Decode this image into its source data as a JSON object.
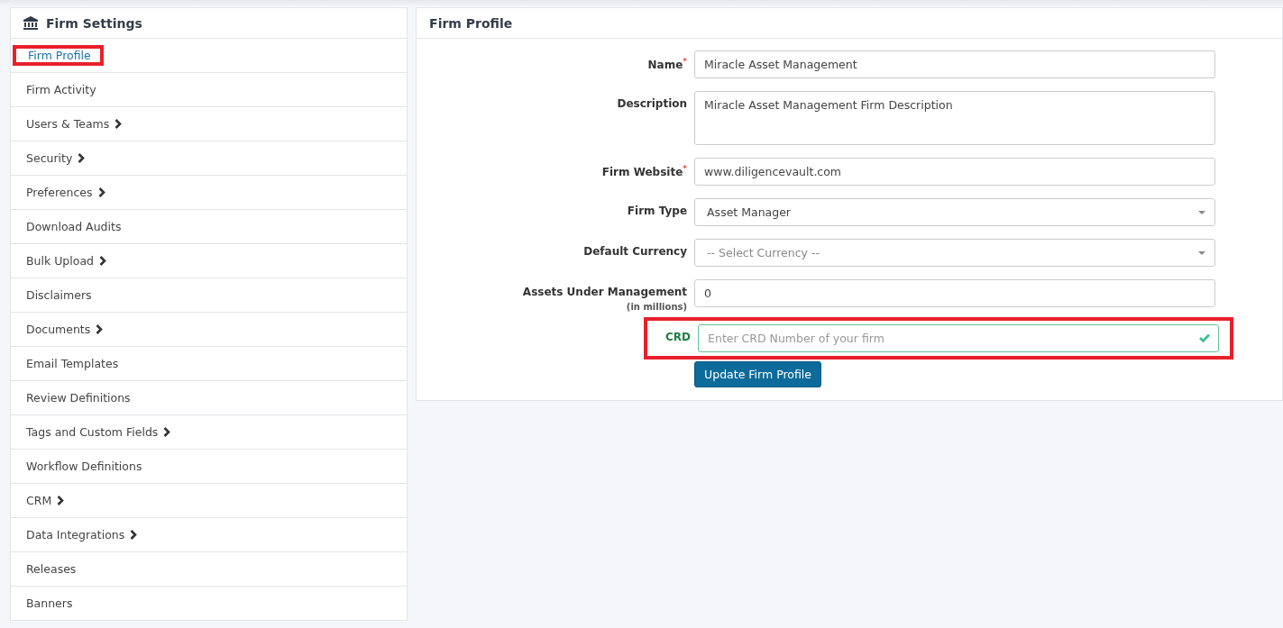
{
  "sidebar": {
    "title": "Firm Settings",
    "items": [
      {
        "label": "Firm Profile",
        "selected": true,
        "highlighted": true,
        "submenu": false
      },
      {
        "label": "Firm Activity",
        "selected": false,
        "highlighted": false,
        "submenu": false
      },
      {
        "label": "Users & Teams",
        "selected": false,
        "highlighted": false,
        "submenu": true
      },
      {
        "label": "Security",
        "selected": false,
        "highlighted": false,
        "submenu": true
      },
      {
        "label": "Preferences",
        "selected": false,
        "highlighted": false,
        "submenu": true
      },
      {
        "label": "Download Audits",
        "selected": false,
        "highlighted": false,
        "submenu": false
      },
      {
        "label": "Bulk Upload",
        "selected": false,
        "highlighted": false,
        "submenu": true
      },
      {
        "label": "Disclaimers",
        "selected": false,
        "highlighted": false,
        "submenu": false
      },
      {
        "label": "Documents",
        "selected": false,
        "highlighted": false,
        "submenu": true
      },
      {
        "label": "Email Templates",
        "selected": false,
        "highlighted": false,
        "submenu": false
      },
      {
        "label": "Review Definitions",
        "selected": false,
        "highlighted": false,
        "submenu": false
      },
      {
        "label": "Tags and Custom Fields",
        "selected": false,
        "highlighted": false,
        "submenu": true
      },
      {
        "label": "Workflow Definitions",
        "selected": false,
        "highlighted": false,
        "submenu": false
      },
      {
        "label": "CRM",
        "selected": false,
        "highlighted": false,
        "submenu": true
      },
      {
        "label": "Data Integrations",
        "selected": false,
        "highlighted": false,
        "submenu": true
      },
      {
        "label": "Releases",
        "selected": false,
        "highlighted": false,
        "submenu": false
      },
      {
        "label": "Banners",
        "selected": false,
        "highlighted": false,
        "submenu": false
      }
    ]
  },
  "panel": {
    "title": "Firm Profile",
    "fields": [
      {
        "kind": "text",
        "label": "Name",
        "required": "*",
        "value": "Miracle Asset Management",
        "highlighted": false
      },
      {
        "kind": "textarea",
        "label": "Description",
        "value": "Miracle Asset Management Firm Description",
        "highlighted": false
      },
      {
        "kind": "text",
        "label": "Firm Website",
        "required": "*",
        "value": "www.diligencevault.com",
        "highlighted": false
      },
      {
        "kind": "select",
        "label": "Firm Type",
        "value": "Asset Manager",
        "highlighted": false
      },
      {
        "kind": "select",
        "label": "Default Currency",
        "placeholder": "-- Select Currency --",
        "highlighted": false
      },
      {
        "kind": "text",
        "label": "Assets Under Management",
        "sublabel": "(in millions)",
        "value": "0",
        "highlighted": false
      },
      {
        "kind": "valid",
        "label": "CRD",
        "placeholder": "Enter CRD Number of your firm",
        "highlighted": true
      }
    ],
    "submit": "Update Firm Profile"
  }
}
